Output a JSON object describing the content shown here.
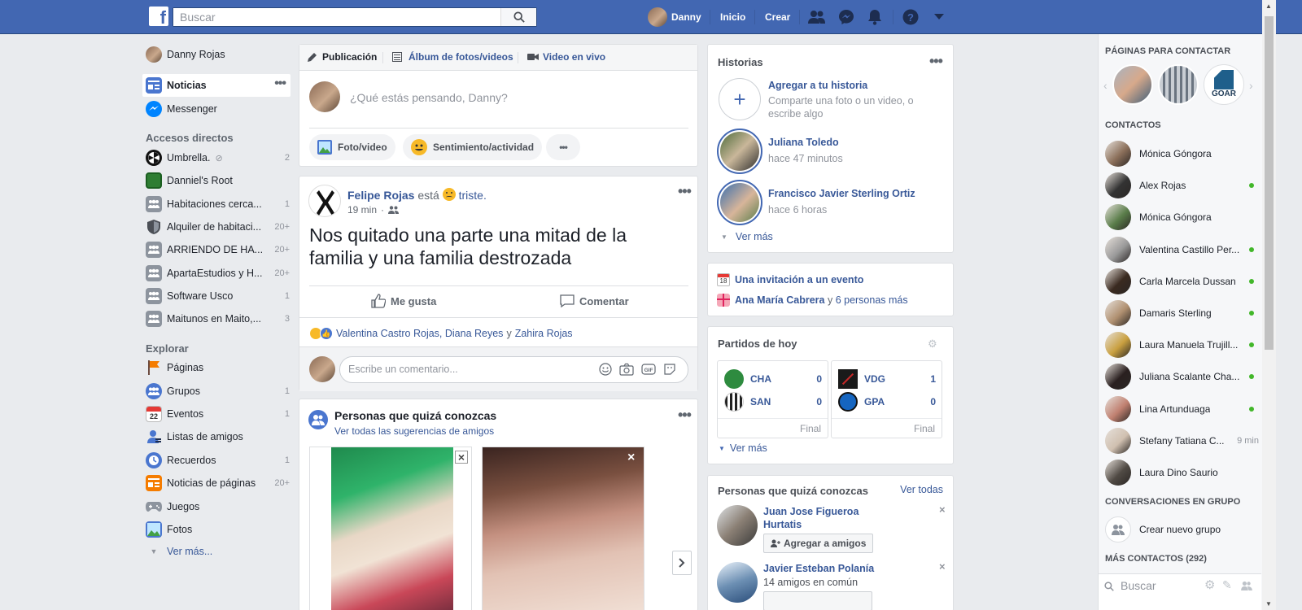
{
  "topbar": {
    "search_placeholder": "Buscar",
    "user_name": "Danny",
    "home": "Inicio",
    "create": "Crear"
  },
  "leftnav": {
    "user": "Danny Rojas",
    "items": [
      {
        "label": "Noticias"
      },
      {
        "label": "Messenger"
      }
    ],
    "shortcuts_title": "Accesos directos",
    "shortcuts": [
      {
        "label": "Umbrella.",
        "count": "2"
      },
      {
        "label": "Danniel's Root",
        "count": ""
      },
      {
        "label": "Habitaciones cerca...",
        "count": "1"
      },
      {
        "label": "Alquiler de habitaci...",
        "count": "20+"
      },
      {
        "label": "ARRIENDO DE HA...",
        "count": "20+"
      },
      {
        "label": "ApartaEstudios y H...",
        "count": "20+"
      },
      {
        "label": "Software Usco",
        "count": "1"
      },
      {
        "label": "Maitunos en Maito,...",
        "count": "3"
      }
    ],
    "explore_title": "Explorar",
    "explore": [
      {
        "label": "Páginas",
        "count": ""
      },
      {
        "label": "Grupos",
        "count": "1"
      },
      {
        "label": "Eventos",
        "count": "1"
      },
      {
        "label": "Listas de amigos",
        "count": ""
      },
      {
        "label": "Recuerdos",
        "count": "1"
      },
      {
        "label": "Noticias de páginas",
        "count": "20+"
      },
      {
        "label": "Juegos",
        "count": ""
      },
      {
        "label": "Fotos",
        "count": ""
      }
    ],
    "see_more": "Ver más..."
  },
  "composer": {
    "tabs": [
      "Publicación",
      "Álbum de fotos/videos",
      "Video en vivo"
    ],
    "placeholder": "¿Qué estás pensando, Danny?",
    "actions": [
      "Foto/video",
      "Sentimiento/actividad"
    ]
  },
  "post": {
    "author": "Felipe Rojas",
    "is": "está",
    "feeling": "triste.",
    "time": "19 min",
    "text": "Nos quitado una parte una mitad de la familia y una familia destrozada",
    "like": "Me gusta",
    "comment": "Comentar",
    "reactors": "Valentina Castro Rojas, Diana Reyes",
    "reactors_and": "y",
    "reactors_last": "Zahira Rojas",
    "comment_placeholder": "Escribe un comentario..."
  },
  "pymk_feed": {
    "title": "Personas que quizá conozcas",
    "link": "Ver todas las sugerencias de amigos"
  },
  "stories": {
    "title": "Historias",
    "add_title": "Agregar a tu historia",
    "add_sub": "Comparte una foto o un video, o escribe algo",
    "items": [
      {
        "name": "Juliana Toledo",
        "time": "hace 47 minutos"
      },
      {
        "name": "Francisco Javier Sterling Ortiz",
        "time": "hace 6 horas"
      }
    ],
    "see_more": "Ver más"
  },
  "events": {
    "invite": "Una invitación a un evento",
    "birthday_name": "Ana María Cabrera",
    "birthday_rest": "y",
    "birthday_more": "6 personas más",
    "calendar_day": "18"
  },
  "matches": {
    "title": "Partidos de hoy",
    "games": [
      {
        "teams": [
          {
            "abbr": "CHA",
            "score": "0"
          },
          {
            "abbr": "SAN",
            "score": "0"
          }
        ],
        "status": "Final"
      },
      {
        "teams": [
          {
            "abbr": "VDG",
            "score": "1"
          },
          {
            "abbr": "GPA",
            "score": "0"
          }
        ],
        "status": "Final"
      }
    ],
    "see_more": "Ver más"
  },
  "pymk_side": {
    "title": "Personas que quizá conozcas",
    "see_all": "Ver todas",
    "people": [
      {
        "name": "Juan Jose Figueroa Hurtatis",
        "sub": ""
      },
      {
        "name": "Javier Esteban Polanía",
        "sub": "14 amigos en común"
      }
    ],
    "add": "Agregar a amigos"
  },
  "right": {
    "pages_title": "PÁGINAS PARA CONTACTAR",
    "goar": "GOAR",
    "contacts_title": "CONTACTOS",
    "contacts": [
      {
        "name": "Mónica Góngora",
        "online": false,
        "time": "",
        "color": "#8b6f5a"
      },
      {
        "name": "Alex Rojas",
        "online": true,
        "time": "",
        "color": "#333333"
      },
      {
        "name": "Mónica Góngora",
        "online": false,
        "time": "",
        "color": "#5a7d4a"
      },
      {
        "name": "Valentina Castillo Per...",
        "online": true,
        "time": "",
        "color": "#9a9a9a"
      },
      {
        "name": "Carla Marcela Dussan",
        "online": true,
        "time": "",
        "color": "#3a2a20"
      },
      {
        "name": "Damaris Sterling",
        "online": true,
        "time": "",
        "color": "#b09070"
      },
      {
        "name": "Laura Manuela Trujill...",
        "online": true,
        "time": "",
        "color": "#c9a040"
      },
      {
        "name": "Juliana Scalante Cha...",
        "online": true,
        "time": "",
        "color": "#2a2020"
      },
      {
        "name": "Lina Artunduaga",
        "online": true,
        "time": "",
        "color": "#c08070"
      },
      {
        "name": "Stefany Tatiana C...",
        "online": false,
        "time": "9 min",
        "color": "#d0c0b0"
      },
      {
        "name": "Laura Dino Saurio",
        "online": false,
        "time": "",
        "color": "#504a44"
      }
    ],
    "groups_title": "CONVERSACIONES EN GRUPO",
    "new_group": "Crear nuevo grupo",
    "more_contacts": "MÁS CONTACTOS (292)",
    "search_placeholder": "Buscar"
  },
  "colors": {
    "brand": "#4267b2",
    "link": "#385898",
    "online": "#42b72a",
    "background": "#e9ebee"
  }
}
